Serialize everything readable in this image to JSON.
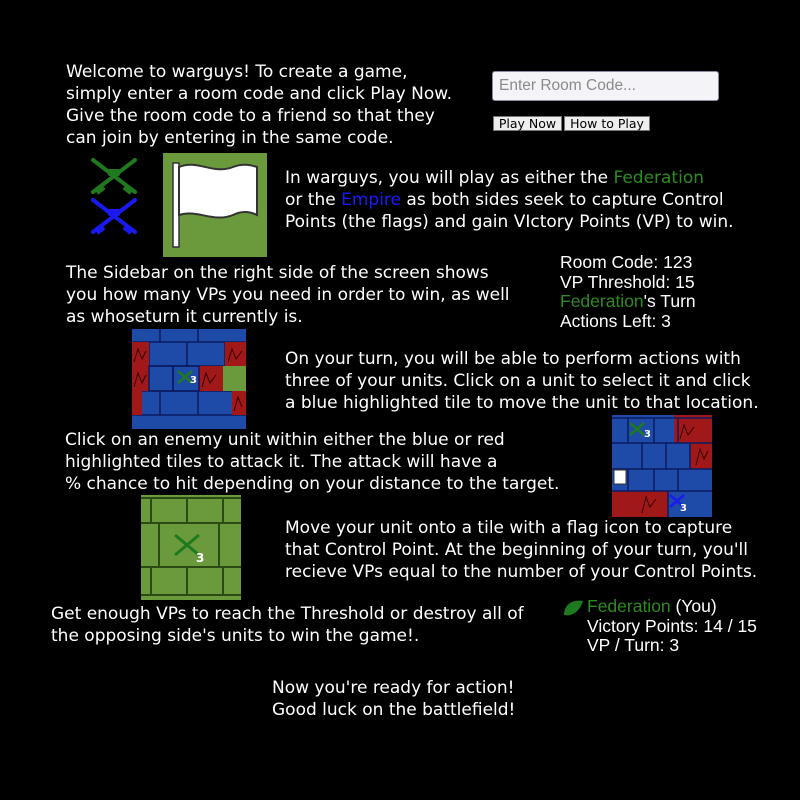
{
  "intro": {
    "lines": [
      "Welcome to warguys! To create a game,",
      "simply enter a room code and click Play Now.",
      "Give the room code to a friend so that they",
      "can join by entering in the same code."
    ]
  },
  "room_input": {
    "placeholder": "Enter Room Code...",
    "value": ""
  },
  "buttons": {
    "play_now": "Play Now",
    "how_to_play": "How to Play"
  },
  "sides_paragraph": {
    "line1_pre": "In warguys, you will play as either the ",
    "federation": "Federation",
    "line2_pre": "or the ",
    "empire": "Empire",
    "line2_post": " as both sides seek to capture Control",
    "line3": "Points (the flags) and gain VIctory Points (VP) to win."
  },
  "sidebar_paragraph": {
    "lines": [
      "The Sidebar on the right side of the screen shows",
      "you how many VPs you need in order to win, as well",
      "as whoseturn it currently is."
    ]
  },
  "sidebar_example": {
    "room_code": "Room Code: 123",
    "vp_threshold": "VP Threshold: 15",
    "turn_side": "Federation",
    "turn_suffix": "'s Turn",
    "actions_left": "Actions Left: 3"
  },
  "move_paragraph": {
    "lines": [
      "On your turn, you will be able to perform actions with",
      "three of your units. Click on a unit to select it and click",
      "a blue highlighted tile to move the unit to that location."
    ]
  },
  "attack_paragraph": {
    "lines": [
      "Click on an enemy unit within either the blue or red",
      "highlighted tiles to attack it. The attack will have a",
      "% chance to hit depending on your distance to the target."
    ]
  },
  "capture_paragraph": {
    "lines": [
      "Move your unit onto a tile with a flag icon to capture",
      "that Control Point. At the beginning of your turn, you'll",
      "recieve VPs equal to the number of your Control Points."
    ]
  },
  "win_paragraph": {
    "lines": [
      "Get enough VPs to reach the Threshold or destroy all of",
      "the opposing side's units to win the game!."
    ]
  },
  "player_example": {
    "side": "Federation",
    "you_label": " (You)",
    "victory_points": "Victory Points: 14 / 15",
    "vp_per_turn": "VP / Turn: 3"
  },
  "closing": {
    "lines": [
      "Now you're ready for action!",
      "Good luck on the battlefield!"
    ]
  },
  "unit_counts": {
    "move_example": "3",
    "attack_friendly": "3",
    "attack_enemy": "3",
    "capture_example": "3"
  },
  "colors": {
    "background": "#000000",
    "federation": "#2e8b22",
    "empire": "#1a1aff",
    "grass": "#6a9a3c",
    "blue_tile": "#1e4aa8",
    "red_tile": "#a01818"
  }
}
